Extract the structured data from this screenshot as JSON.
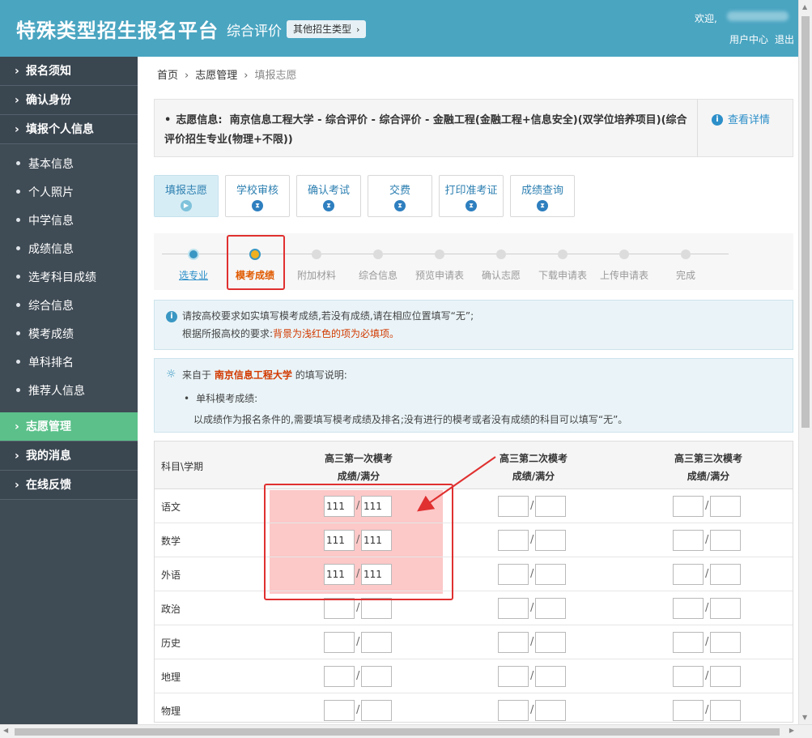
{
  "header": {
    "title": "特殊类型招生报名平台",
    "subtitle": "综合评价",
    "other_types_label": "其他招生类型",
    "welcome": "欢迎,",
    "user_center": "用户中心",
    "logout": "退出",
    "bg_color": "#4aa5c1"
  },
  "sidebar": {
    "top_items": [
      {
        "label": "报名须知"
      },
      {
        "label": "确认身份"
      },
      {
        "label": "填报个人信息"
      }
    ],
    "sub_items": [
      {
        "label": "基本信息"
      },
      {
        "label": "个人照片"
      },
      {
        "label": "中学信息"
      },
      {
        "label": "成绩信息"
      },
      {
        "label": "选考科目成绩"
      },
      {
        "label": "综合信息"
      },
      {
        "label": "模考成绩"
      },
      {
        "label": "单科排名"
      },
      {
        "label": "推荐人信息"
      }
    ],
    "bottom_items": [
      {
        "label": "志愿管理",
        "active": true
      },
      {
        "label": "我的消息"
      },
      {
        "label": "在线反馈"
      }
    ],
    "active_color": "#5bc08a"
  },
  "breadcrumb": {
    "home": "首页",
    "section": "志愿管理",
    "current": "填报志愿"
  },
  "info": {
    "label": "志愿信息:",
    "text": "南京信息工程大学 - 综合评价 - 综合评价 - 金融工程(金融工程+信息安全)(双学位培养项目)(综合评价招生专业(物理+不限))",
    "detail_link": "查看详情"
  },
  "steps_tabs": [
    {
      "label": "填报志愿",
      "active": true
    },
    {
      "label": "学校审核"
    },
    {
      "label": "确认考试"
    },
    {
      "label": "交费"
    },
    {
      "label": "打印准考证"
    },
    {
      "label": "成绩查询"
    }
  ],
  "progress": [
    {
      "label": "选专业",
      "state": "done"
    },
    {
      "label": "模考成绩",
      "state": "current"
    },
    {
      "label": "附加材料",
      "state": "todo"
    },
    {
      "label": "综合信息",
      "state": "todo"
    },
    {
      "label": "预览申请表",
      "state": "todo"
    },
    {
      "label": "确认志愿",
      "state": "todo"
    },
    {
      "label": "下载申请表",
      "state": "todo"
    },
    {
      "label": "上传申请表",
      "state": "todo"
    },
    {
      "label": "完成",
      "state": "todo"
    }
  ],
  "notice": {
    "line1": "请按高校要求如实填写模考成绩,若没有成绩,请在相应位置填写“无”;",
    "line2_prefix": "根据所报高校的要求:",
    "line2_red": "背景为浅红色的项为必填项。"
  },
  "explain": {
    "prefix": "来自于",
    "school": "南京信息工程大学",
    "suffix": "的填写说明:",
    "item_title": "单科模考成绩:",
    "item_text": "以成绩作为报名条件的,需要填写模考成绩及排名;没有进行的模考或者没有成绩的科目可以填写“无”。"
  },
  "table": {
    "subject_header": "科目\\学期",
    "columns": [
      {
        "title": "高三第一次模考",
        "sub": "成绩/满分"
      },
      {
        "title": "高三第二次模考",
        "sub": "成绩/满分"
      },
      {
        "title": "高三第三次模考",
        "sub": "成绩/满分"
      }
    ],
    "rows": [
      {
        "subject": "语文",
        "values": [
          [
            "111",
            "111"
          ],
          [
            "",
            ""
          ],
          [
            "",
            ""
          ]
        ]
      },
      {
        "subject": "数学",
        "values": [
          [
            "111",
            "111"
          ],
          [
            "",
            ""
          ],
          [
            "",
            ""
          ]
        ]
      },
      {
        "subject": "外语",
        "values": [
          [
            "111",
            "111"
          ],
          [
            "",
            ""
          ],
          [
            "",
            ""
          ]
        ]
      },
      {
        "subject": "政治",
        "values": [
          [
            "",
            ""
          ],
          [
            "",
            ""
          ],
          [
            "",
            ""
          ]
        ]
      },
      {
        "subject": "历史",
        "values": [
          [
            "",
            ""
          ],
          [
            "",
            ""
          ],
          [
            "",
            ""
          ]
        ]
      },
      {
        "subject": "地理",
        "values": [
          [
            "",
            ""
          ],
          [
            "",
            ""
          ],
          [
            "",
            ""
          ]
        ]
      },
      {
        "subject": "物理",
        "values": [
          [
            "",
            ""
          ],
          [
            "",
            ""
          ],
          [
            "",
            ""
          ]
        ]
      }
    ],
    "required_bg": "#fcc8c8"
  },
  "annotation_color": "#e03030"
}
